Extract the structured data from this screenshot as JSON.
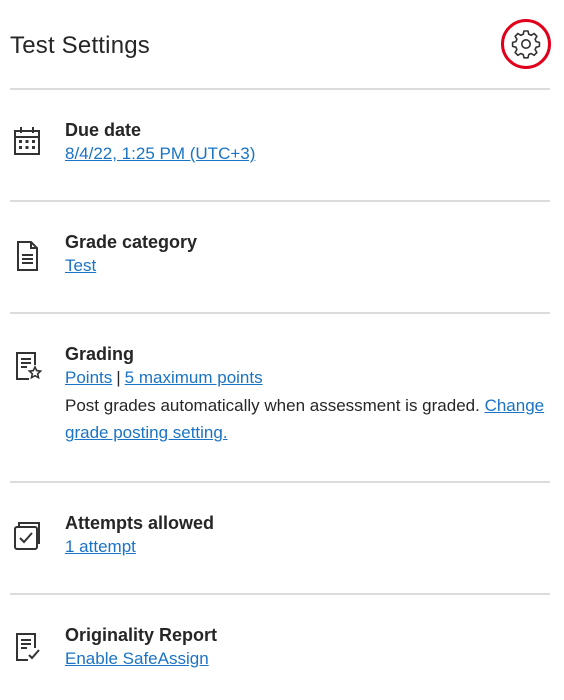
{
  "header": {
    "title": "Test Settings",
    "settings_icon": "gear-icon",
    "highlight_color": "#e0001b"
  },
  "colors": {
    "link": "#1a73c5",
    "text": "#262626",
    "divider": "#dcdcdc"
  },
  "settings": {
    "due_date": {
      "icon": "calendar-icon",
      "label": "Due date",
      "value": "8/4/22, 1:25 PM (UTC+3)"
    },
    "grade_category": {
      "icon": "document-icon",
      "label": "Grade category",
      "value": "Test"
    },
    "grading": {
      "icon": "grading-star-icon",
      "label": "Grading",
      "scheme": "Points",
      "separator": "|",
      "max_points": "5 maximum points",
      "description": "Post grades automatically when assessment is graded.",
      "change_link": "Change grade posting setting."
    },
    "attempts": {
      "icon": "checkbox-icon",
      "label": "Attempts allowed",
      "value": "1 attempt"
    },
    "originality": {
      "icon": "checklist-icon",
      "label": "Originality Report",
      "value": "Enable SafeAssign"
    }
  }
}
